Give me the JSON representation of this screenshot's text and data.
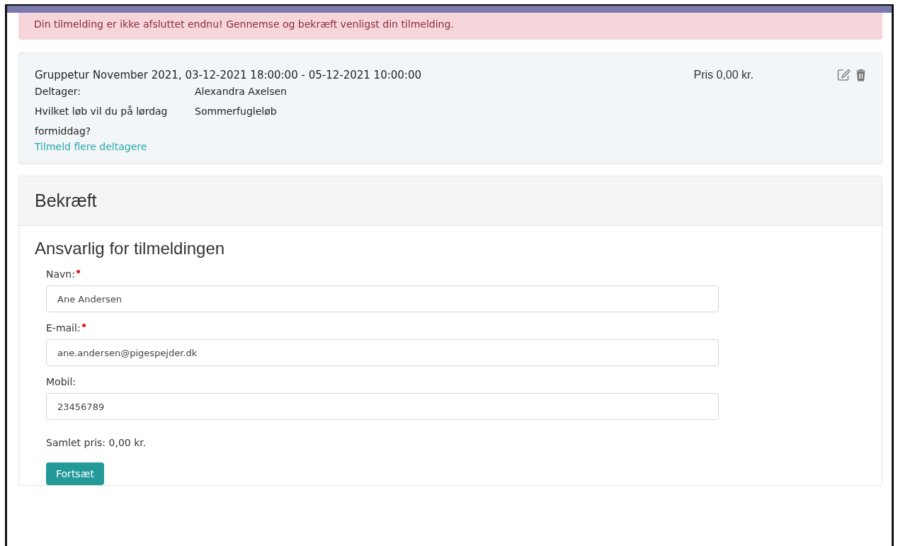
{
  "alert": {
    "text": "Din tilmelding er ikke afsluttet endnu! Gennemse og bekræft venligst din tilmelding."
  },
  "registration": {
    "title": "Gruppetur November 2021, 03-12-2021 18:00:00 - 05-12-2021 10:00:00",
    "price": "Pris 0,00 kr.",
    "details": [
      {
        "label": "Deltager:",
        "value": "Alexandra Axelsen"
      },
      {
        "label": "Hvilket løb vil du på lørdag formiddag?",
        "value": "Sommerfugleløb"
      }
    ],
    "add_link": "Tilmeld flere deltagere"
  },
  "confirm": {
    "heading": "Bekræft",
    "section_title": "Ansvarlig for tilmeldingen",
    "fields": [
      {
        "label": "Navn:",
        "required": true,
        "value": "Ane Andersen"
      },
      {
        "label": "E-mail:",
        "required": true,
        "value": "ane.andersen@pigespejder.dk"
      },
      {
        "label": "Mobil:",
        "required": false,
        "value": "23456789"
      }
    ],
    "total": "Samlet pris: 0,00 kr.",
    "button": "Fortsæt"
  }
}
